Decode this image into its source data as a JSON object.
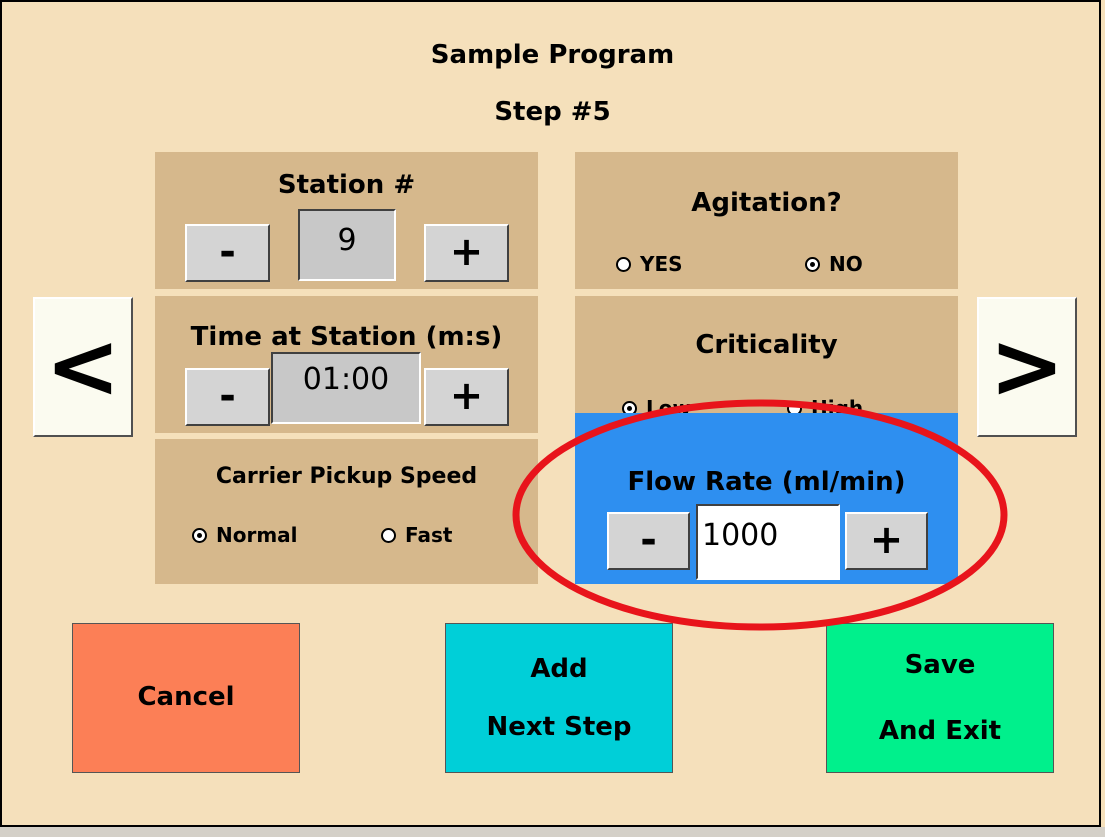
{
  "header": {
    "title": "Sample Program",
    "step": "Step #5"
  },
  "station": {
    "label": "Station #",
    "value": "9",
    "minus": "-",
    "plus": "+"
  },
  "time": {
    "label": "Time at Station (m:s)",
    "value": "01:00",
    "minus": "-",
    "plus": "+"
  },
  "carrier": {
    "label": "Carrier Pickup Speed",
    "options": [
      "Normal",
      "Fast"
    ],
    "selected": "Normal"
  },
  "agitation": {
    "label": "Agitation?",
    "options": [
      "YES",
      "NO"
    ],
    "selected": "NO"
  },
  "criticality": {
    "label": "Criticality",
    "options": [
      "Low",
      "High"
    ],
    "selected": "Low"
  },
  "flow": {
    "label": "Flow Rate (ml/min)",
    "value": "1000",
    "minus": "-",
    "plus": "+"
  },
  "nav": {
    "prev": "<",
    "next": ">"
  },
  "actions": {
    "cancel": [
      "Cancel"
    ],
    "add": [
      "Add",
      "Next Step"
    ],
    "save": [
      "Save",
      "And Exit"
    ]
  },
  "colors": {
    "background": "#f5e0bb",
    "panel": "#d6b88c",
    "flow_panel": "#2e8ff0",
    "cancel": "#fc7f56",
    "add": "#00cfd8",
    "save": "#00f08c",
    "highlight_ellipse": "#e8141b"
  }
}
